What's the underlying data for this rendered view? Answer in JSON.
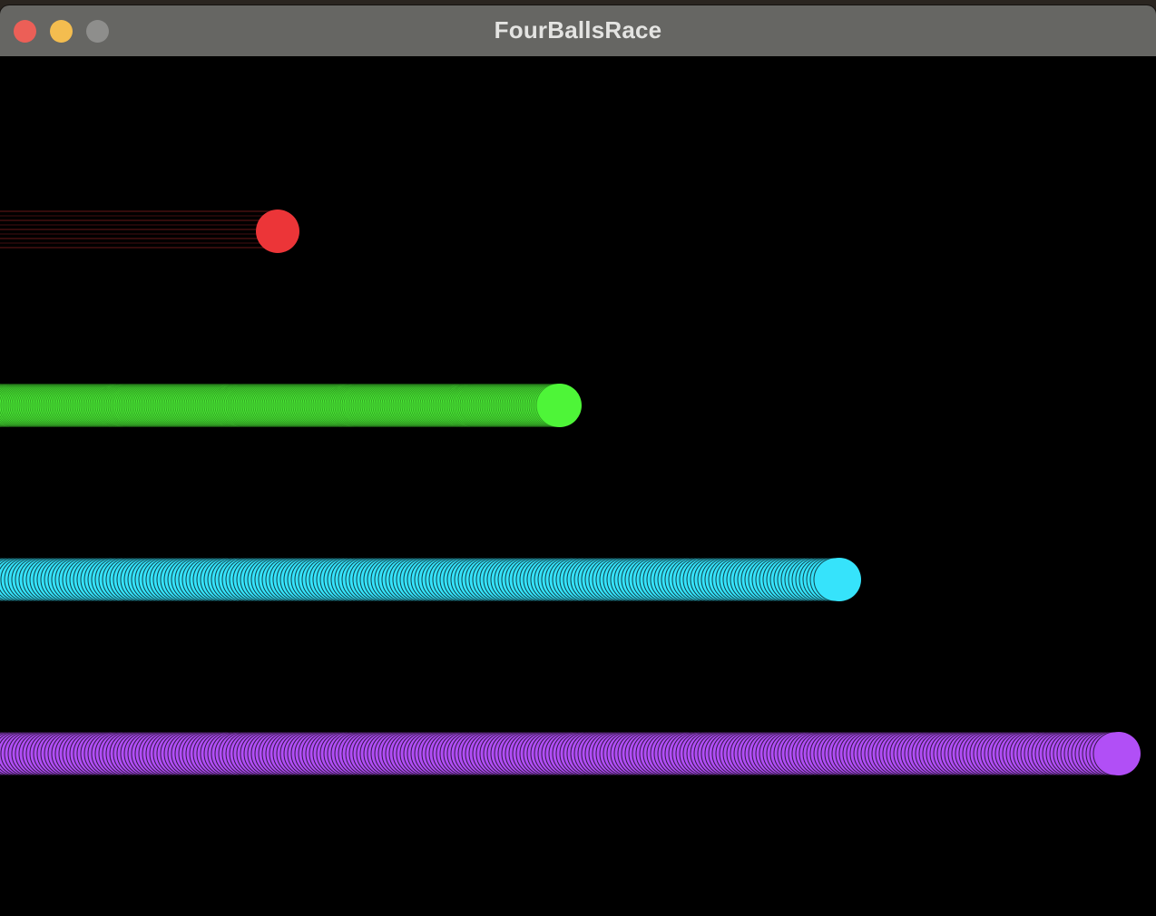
{
  "window": {
    "title": "FourBallsRace",
    "controls": {
      "close_color": "#ec5f57",
      "minimize_color": "#f4bd4f",
      "zoom_color": "#8e8e8c"
    }
  },
  "race": {
    "background": "#000000",
    "balls": [
      {
        "name": "red-ball",
        "color": "#ec3538",
        "trail_style": "faint",
        "progress": 0.24
      },
      {
        "name": "green-ball",
        "color": "#4ef538",
        "trail_style": "dense",
        "progress": 0.484
      },
      {
        "name": "cyan-ball",
        "color": "#36e3fb",
        "trail_style": "rings",
        "progress": 0.726
      },
      {
        "name": "purple-ball",
        "color": "#b14ff6",
        "trail_style": "rings",
        "progress": 0.968
      }
    ]
  }
}
